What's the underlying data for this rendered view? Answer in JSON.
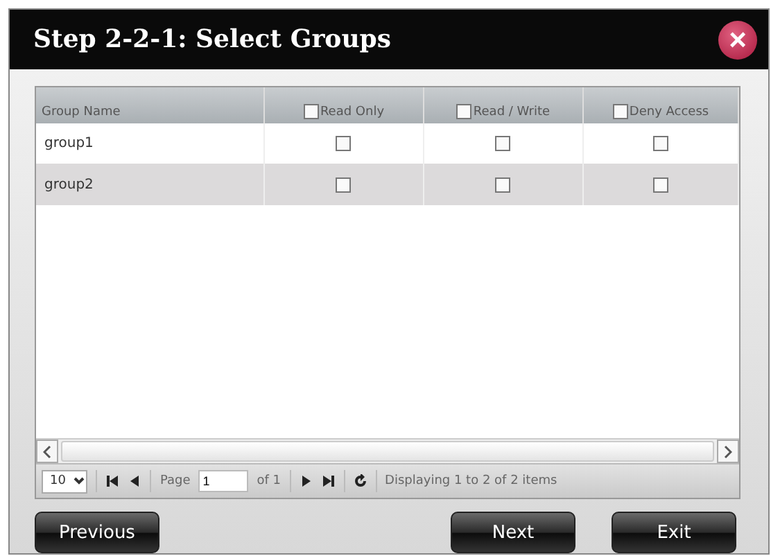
{
  "window": {
    "title": "Step 2-2-1: Select Groups",
    "close": "×"
  },
  "table": {
    "columns": [
      {
        "label": "Group Name",
        "kind": "text"
      },
      {
        "label": "Read Only",
        "kind": "check",
        "checked": false
      },
      {
        "label": "Read / Write",
        "kind": "check",
        "checked": false
      },
      {
        "label": "Deny Access",
        "kind": "check",
        "checked": false
      }
    ],
    "rows": [
      {
        "name": "group1",
        "checks": [
          false,
          false,
          false
        ],
        "selected": false
      },
      {
        "name": "group2",
        "checks": [
          false,
          false,
          false
        ],
        "selected": true
      }
    ]
  },
  "pager": {
    "page_size": "10",
    "page_label": "Page",
    "page": "1",
    "of": "of 1",
    "status": "Displaying 1 to 2 of 2 items"
  },
  "buttons": [
    {
      "label": "Previous"
    },
    {
      "label": "Next"
    },
    {
      "label": "Exit"
    }
  ]
}
